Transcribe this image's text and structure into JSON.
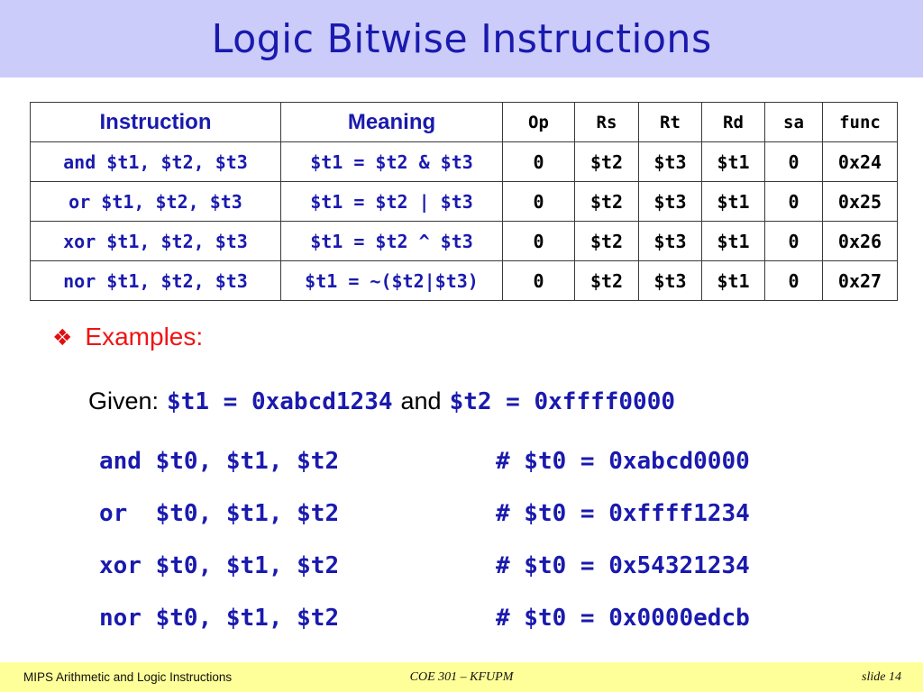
{
  "slide": {
    "title": "Logic Bitwise Instructions",
    "banner_color": "#ccccfa",
    "title_color": "#1a1aae"
  },
  "table": {
    "headers": {
      "instruction": "Instruction",
      "meaning": "Meaning",
      "op": "Op",
      "rs": "Rs",
      "rt": "Rt",
      "rd": "Rd",
      "sa": "sa",
      "func": "func"
    },
    "rows": [
      {
        "instruction": "and $t1, $t2, $t3",
        "meaning": "$t1 = $t2 & $t3",
        "op": "0",
        "rs": "$t2",
        "rt": "$t3",
        "rd": "$t1",
        "sa": "0",
        "func": "0x24"
      },
      {
        "instruction": "or  $t1, $t2, $t3",
        "meaning": "$t1 = $t2 | $t3",
        "op": "0",
        "rs": "$t2",
        "rt": "$t3",
        "rd": "$t1",
        "sa": "0",
        "func": "0x25"
      },
      {
        "instruction": "xor $t1, $t2, $t3",
        "meaning": "$t1 = $t2 ^ $t3",
        "op": "0",
        "rs": "$t2",
        "rt": "$t3",
        "rd": "$t1",
        "sa": "0",
        "func": "0x26"
      },
      {
        "instruction": "nor $t1, $t2, $t3",
        "meaning": "$t1 = ~($t2|$t3)",
        "op": "0",
        "rs": "$t2",
        "rt": "$t3",
        "rd": "$t1",
        "sa": "0",
        "func": "0x27"
      }
    ]
  },
  "examples": {
    "bullet_glyph": "❖",
    "bullet_color": "#f01414",
    "label": "Examples:",
    "given": {
      "prefix": "Given:",
      "value1": "$t1 = 0xabcd1234",
      "conjunction": "and",
      "value2": "$t2 = 0xffff0000"
    },
    "code_lines": [
      {
        "instruction": "and $t0, $t1, $t2",
        "comment": "# $t0 = 0xabcd0000"
      },
      {
        "instruction": "or  $t0, $t1, $t2",
        "comment": "# $t0 = 0xffff1234"
      },
      {
        "instruction": "xor $t0, $t1, $t2",
        "comment": "# $t0 = 0x54321234"
      },
      {
        "instruction": "nor $t0, $t1, $t2",
        "comment": "# $t0 = 0x0000edcb"
      }
    ]
  },
  "footer": {
    "left": "MIPS Arithmetic and Logic Instructions",
    "center": "COE 301 – KFUPM",
    "right": "slide 14",
    "background": "#ffff99"
  }
}
